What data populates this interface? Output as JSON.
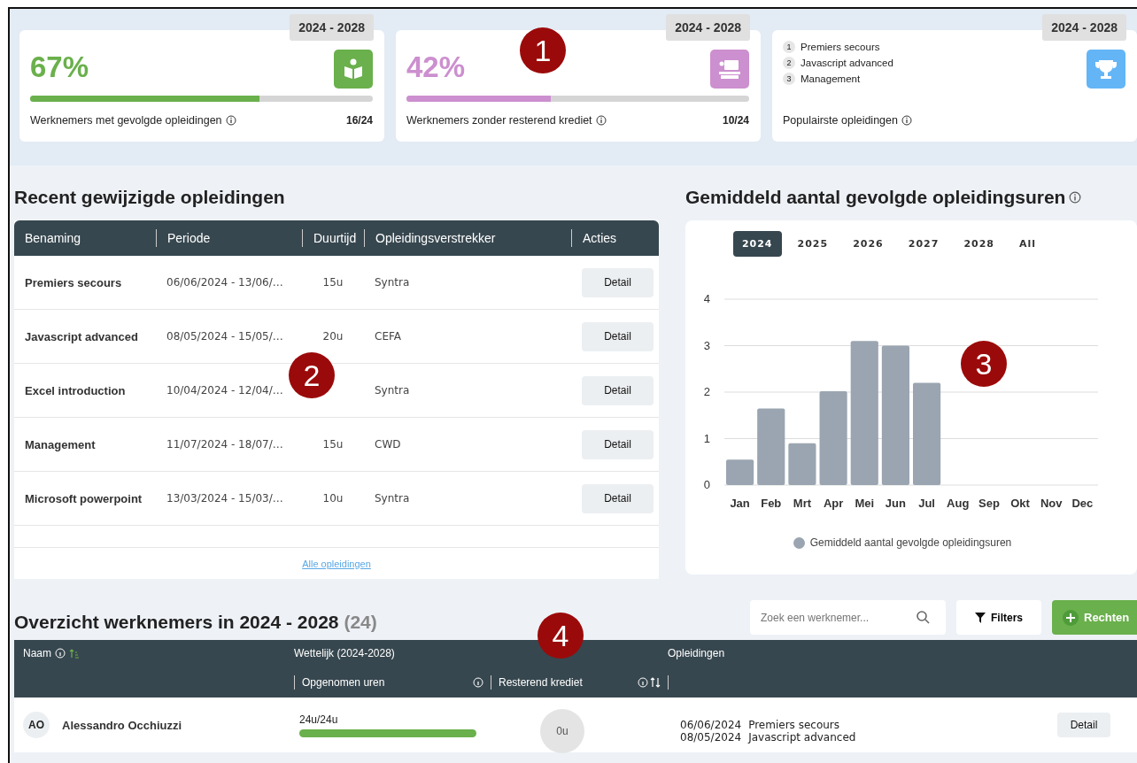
{
  "cards": [
    {
      "kind": "progress",
      "period": "2024 - 2028",
      "value": "67%",
      "color": "#6ab04c",
      "level": 0.67,
      "label": "Werknemers met gevolgde opleidingen",
      "count": "16/24"
    },
    {
      "kind": "progress",
      "period": "2024 - 2028",
      "value": "42%",
      "color": "#cc8fcf",
      "level": 0.42,
      "label": "Werknemers zonder resterend krediet",
      "count": "10/24"
    },
    {
      "kind": "ranking",
      "period": "2024 - 2028",
      "color": "#64b5f6",
      "items": [
        {
          "rank": "1",
          "name": "Premiers secours"
        },
        {
          "rank": "2",
          "name": "Javascript advanced"
        },
        {
          "rank": "3",
          "name": "Management"
        }
      ],
      "label": "Populairste opleidingen"
    }
  ],
  "recent": {
    "title": "Recent gewijzigde opleidingen",
    "columns": [
      "Benaming",
      "Periode",
      "Duurtijd",
      "Opleidingsverstrekker",
      "Acties"
    ],
    "rows": [
      {
        "name": "Premiers secours",
        "period": "06/06/2024 - 13/06/…",
        "duration": "15u",
        "provider": "Syntra",
        "action": "Detail"
      },
      {
        "name": "Javascript advanced",
        "period": "08/05/2024 - 15/05/…",
        "duration": "20u",
        "provider": "CEFA",
        "action": "Detail"
      },
      {
        "name": "Excel introduction",
        "period": "10/04/2024 - 12/04/…",
        "provider": "Syntra",
        "action": "Detail"
      },
      {
        "name": "Management",
        "period": "11/07/2024 - 18/07/…",
        "duration": "15u",
        "provider": "CWD",
        "action": "Detail"
      },
      {
        "name": "Microsoft powerpoint",
        "period": "13/03/2024 - 15/03/…",
        "duration": "10u",
        "provider": "Syntra",
        "action": "Detail"
      }
    ],
    "link": "Alle opleidingen"
  },
  "hours": {
    "title": "Gemiddeld aantal gevolgde opleidingsuren",
    "years": [
      {
        "label": "2024",
        "selected": true
      },
      {
        "label": "2025",
        "selected": false
      },
      {
        "label": "2026",
        "selected": false
      },
      {
        "label": "2027",
        "selected": false
      },
      {
        "label": "2028",
        "selected": false
      },
      {
        "label": "All",
        "selected": false
      }
    ],
    "chart_data": {
      "type": "bar",
      "categories": [
        "Jan",
        "Feb",
        "Mrt",
        "Apr",
        "Mei",
        "Jun",
        "Jul",
        "Aug",
        "Sep",
        "Okt",
        "Nov",
        "Dec"
      ],
      "series": [
        {
          "name": "Gemiddeld aantal gevolgde opleidingsuren",
          "color": "#9aa5b1",
          "values": [
            0.55,
            1.65,
            0.9,
            2.02,
            3.1,
            3.0,
            2.2,
            null,
            null,
            null,
            null,
            null
          ]
        }
      ],
      "ylim": [
        0,
        4
      ],
      "yticks": [
        0,
        1,
        2,
        3,
        4
      ],
      "grid": true
    }
  },
  "employees": {
    "title": "Overzicht werknemers in 2024 - 2028",
    "count": "(24)",
    "search": {
      "placeholder": "Zoek een werknemer..."
    },
    "filters": "Filters",
    "rights": "Rechten",
    "header": {
      "name": "Naam",
      "legal": "Wettelijk (2024-2028)",
      "taken": "Opgenomen uren",
      "remaining": "Resterend krediet",
      "trainings": "Opleidingen"
    },
    "rows": [
      {
        "initials": "AO",
        "name": "Alessandro Occhiuzzi",
        "hours": "24u/24u",
        "level": 1,
        "remaining": "0u",
        "trainings": [
          {
            "date": "06/06/2024",
            "name": "Premiers secours"
          },
          {
            "date": "08/05/2024",
            "name": "Javascript advanced"
          }
        ],
        "action": "Detail"
      }
    ]
  },
  "callouts": [
    "1",
    "2",
    "3",
    "4"
  ]
}
